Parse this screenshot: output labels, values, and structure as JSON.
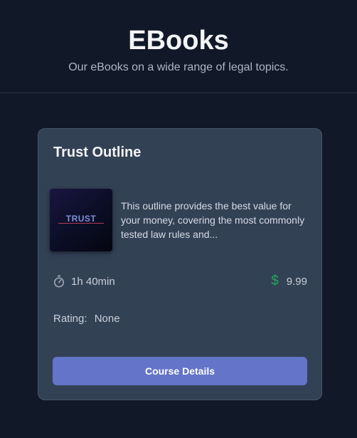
{
  "header": {
    "title": "EBooks",
    "subtitle": "Our eBooks on a wide range of legal topics."
  },
  "card": {
    "title": "Trust Outline",
    "thumbnail_text": "TRUST",
    "description": "This outline provides the best value for your money, covering the most commonly tested law rules and...",
    "duration": "1h 40min",
    "duration_icon": "stopwatch-icon",
    "price_icon": "dollar-icon",
    "price": "9.99",
    "rating_label": "Rating:",
    "rating_value": "None",
    "button_label": "Course Details"
  },
  "colors": {
    "background": "#111827",
    "card": "#334155",
    "button": "#6474c8",
    "price_icon": "#22a65a"
  }
}
